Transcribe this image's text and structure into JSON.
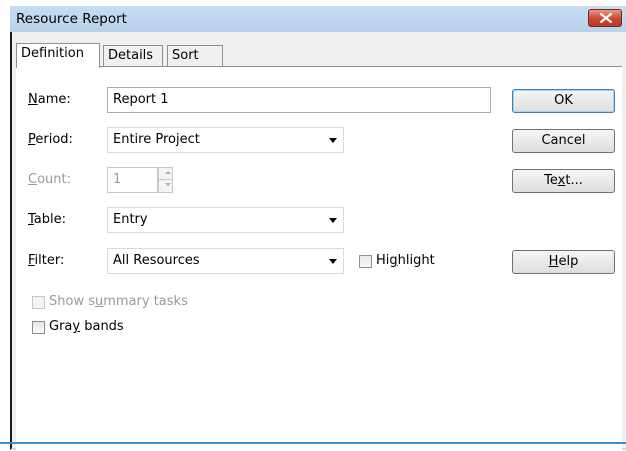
{
  "window": {
    "title": "Resource Report"
  },
  "tabs": [
    {
      "label": "Definition",
      "active": true
    },
    {
      "label": "Details",
      "active": false
    },
    {
      "label": "Sort",
      "active": false
    }
  ],
  "fields": {
    "name": {
      "label_mnemonic": "N",
      "label_rest": "ame:",
      "value": "Report 1"
    },
    "period": {
      "label_mnemonic": "P",
      "label_rest": "eriod:",
      "value": "Entire Project"
    },
    "count": {
      "label_mnemonic": "C",
      "label_rest": "ount:",
      "value": "1"
    },
    "table": {
      "label_mnemonic": "T",
      "label_rest": "able:",
      "value": "Entry"
    },
    "filter": {
      "label_mnemonic": "F",
      "label_rest": "ilter:",
      "value": "All Resources"
    }
  },
  "checkboxes": {
    "highlight": {
      "pre": "Hi",
      "mnemonic": "g",
      "post": "hlight",
      "checked": false
    },
    "show_summary": {
      "pre": "Show s",
      "mnemonic": "u",
      "post": "mmary tasks",
      "checked": false,
      "enabled": false
    },
    "gray_bands": {
      "pre": "Gra",
      "mnemonic": "y",
      "post": " bands",
      "checked": false
    }
  },
  "buttons": {
    "ok": "OK",
    "cancel": "Cancel",
    "text": {
      "pre": "Te",
      "mnemonic": "x",
      "post": "t..."
    },
    "help": {
      "pre": "",
      "mnemonic": "H",
      "post": "elp"
    }
  },
  "colors": {
    "titlebar": "#c4daf0",
    "close_button": "#c9462f",
    "default_button_border": "#3c7fb1"
  }
}
